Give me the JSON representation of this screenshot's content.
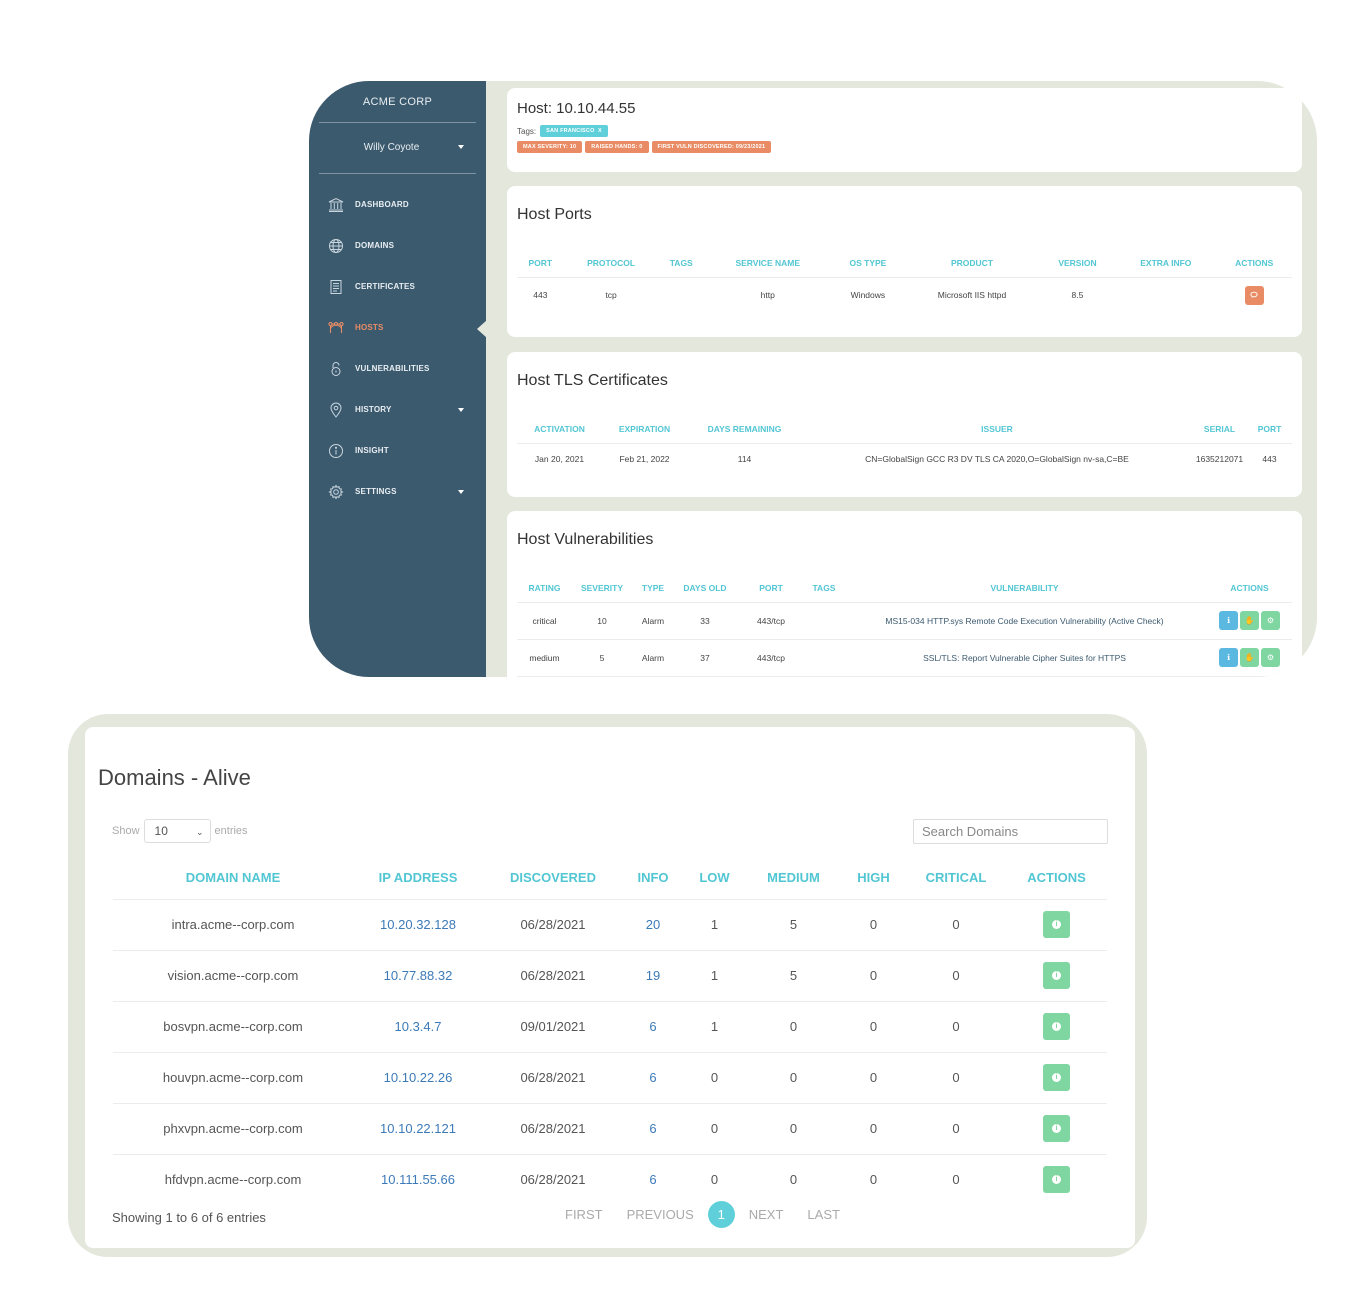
{
  "colors": {
    "sidebar": "#3c5a6e",
    "accent_teal": "#52c6d3",
    "accent_orange": "#e98c66",
    "action_green": "#7fd6a1",
    "action_blue": "#5bb8e0"
  },
  "sidebar": {
    "brand": "ACME CORP",
    "user": "Willy Coyote",
    "items": [
      {
        "label": "DASHBOARD",
        "icon": "bank-icon"
      },
      {
        "label": "DOMAINS",
        "icon": "globe-icon"
      },
      {
        "label": "CERTIFICATES",
        "icon": "certificate-icon"
      },
      {
        "label": "HOSTS",
        "icon": "network-icon"
      },
      {
        "label": "VULNERABILITIES",
        "icon": "lock-icon"
      },
      {
        "label": "HISTORY",
        "icon": "map-pin-icon"
      },
      {
        "label": "INSIGHT",
        "icon": "info-icon"
      },
      {
        "label": "SETTINGS",
        "icon": "gear-icon"
      }
    ]
  },
  "host": {
    "title": "Host: 10.10.44.55",
    "tags_label": "Tags:",
    "tag": "SAN FRANCISCO",
    "tag_remove": "X",
    "badges": [
      "MAX SEVERITY: 10",
      "RAISED HANDS: 0",
      "FIRST VULN DISCOVERED: 09/23/2021"
    ]
  },
  "ports": {
    "title": "Host Ports",
    "headers": [
      "PORT",
      "PROTOCOL",
      "TAGS",
      "SERVICE NAME",
      "OS TYPE",
      "PRODUCT",
      "VERSION",
      "EXTRA INFO",
      "ACTIONS"
    ],
    "row": {
      "port": "443",
      "protocol": "tcp",
      "tags": "",
      "service": "http",
      "os": "Windows",
      "product": "Microsoft IIS httpd",
      "version": "8.5",
      "extra": ""
    }
  },
  "tls": {
    "title": "Host TLS Certificates",
    "headers": [
      "ACTIVATION",
      "EXPIRATION",
      "DAYS REMAINING",
      "ISSUER",
      "SERIAL",
      "PORT"
    ],
    "row": {
      "activation": "Jan 20, 2021",
      "expiration": "Feb 21, 2022",
      "days": "114",
      "issuer": "CN=GlobalSign GCC R3 DV TLS CA 2020,O=GlobalSign nv-sa,C=BE",
      "serial": "1635212071",
      "port": "443"
    }
  },
  "vulns": {
    "title": "Host Vulnerabilities",
    "headers": [
      "RATING",
      "SEVERITY",
      "TYPE",
      "DAYS OLD",
      "PORT",
      "TAGS",
      "VULNERABILITY",
      "ACTIONS"
    ],
    "rows": [
      {
        "rating": "critical",
        "severity": "10",
        "type": "Alarm",
        "days": "33",
        "port": "443/tcp",
        "tags": "",
        "name": "MS15-034 HTTP.sys Remote Code Execution Vulnerability (Active Check)"
      },
      {
        "rating": "medium",
        "severity": "5",
        "type": "Alarm",
        "days": "37",
        "port": "443/tcp",
        "tags": "",
        "name": "SSL/TLS: Report Vulnerable Cipher Suites for HTTPS"
      }
    ]
  },
  "domains": {
    "title": "Domains - Alive",
    "show_label": "Show",
    "show_value": "10",
    "entries_label": "entries",
    "search_placeholder": "Search Domains",
    "headers": [
      "DOMAIN NAME",
      "IP ADDRESS",
      "DISCOVERED",
      "INFO",
      "LOW",
      "MEDIUM",
      "HIGH",
      "CRITICAL",
      "ACTIONS"
    ],
    "rows": [
      {
        "domain": "intra.acme--corp.com",
        "ip": "10.20.32.128",
        "discovered": "06/28/2021",
        "info": "20",
        "low": "1",
        "medium": "5",
        "high": "0",
        "critical": "0"
      },
      {
        "domain": "vision.acme--corp.com",
        "ip": "10.77.88.32",
        "discovered": "06/28/2021",
        "info": "19",
        "low": "1",
        "medium": "5",
        "high": "0",
        "critical": "0"
      },
      {
        "domain": "bosvpn.acme--corp.com",
        "ip": "10.3.4.7",
        "discovered": "09/01/2021",
        "info": "6",
        "low": "1",
        "medium": "0",
        "high": "0",
        "critical": "0"
      },
      {
        "domain": "houvpn.acme--corp.com",
        "ip": "10.10.22.26",
        "discovered": "06/28/2021",
        "info": "6",
        "low": "0",
        "medium": "0",
        "high": "0",
        "critical": "0"
      },
      {
        "domain": "phxvpn.acme--corp.com",
        "ip": "10.10.22.121",
        "discovered": "06/28/2021",
        "info": "6",
        "low": "0",
        "medium": "0",
        "high": "0",
        "critical": "0"
      },
      {
        "domain": "hfdvpn.acme--corp.com",
        "ip": "10.111.55.66",
        "discovered": "06/28/2021",
        "info": "6",
        "low": "0",
        "medium": "0",
        "high": "0",
        "critical": "0"
      }
    ],
    "showing": "Showing 1 to 6 of 6 entries",
    "pager": {
      "first": "FIRST",
      "previous": "PREVIOUS",
      "current": "1",
      "next": "NEXT",
      "last": "LAST"
    }
  }
}
